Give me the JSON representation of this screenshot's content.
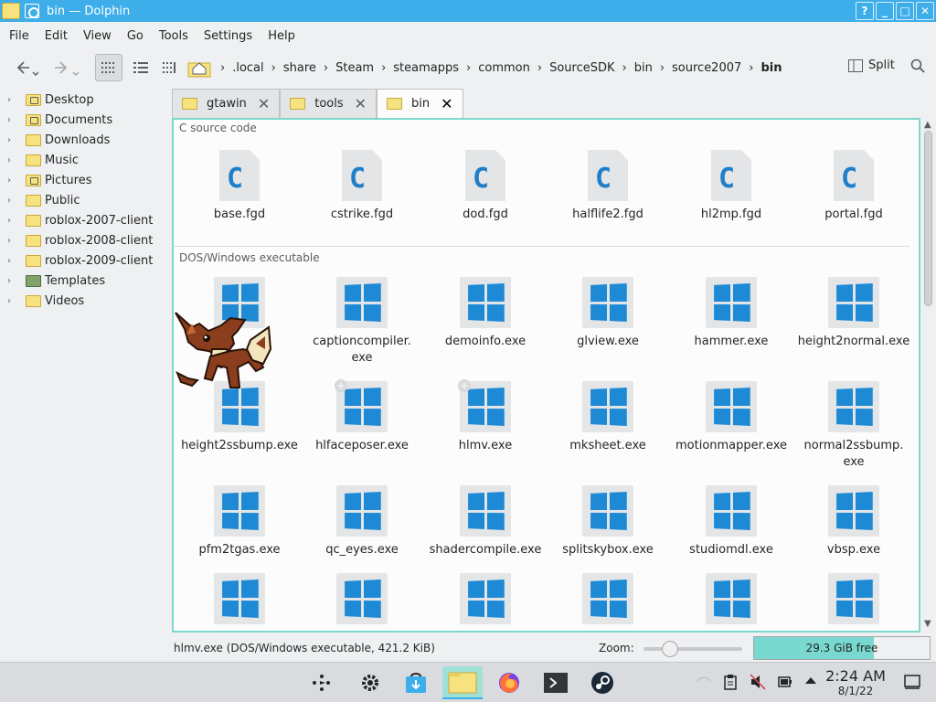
{
  "window": {
    "title": "bin — Dolphin",
    "buttons": [
      "?",
      "_",
      "□",
      "✕"
    ]
  },
  "menubar": [
    {
      "label": "File"
    },
    {
      "label": "Edit"
    },
    {
      "label": "View"
    },
    {
      "label": "Go"
    },
    {
      "label": "Tools"
    },
    {
      "label": "Settings"
    },
    {
      "label": "Help"
    }
  ],
  "toolbar": {
    "breadcrumbs": [
      ".local",
      "share",
      "Steam",
      "steamapps",
      "common",
      "SourceSDK",
      "bin",
      "source2007",
      "bin"
    ],
    "split_label": "Split"
  },
  "places": [
    {
      "label": "Desktop",
      "icon": "desktop-folder-icon"
    },
    {
      "label": "Documents",
      "icon": "documents-folder-icon"
    },
    {
      "label": "Downloads",
      "icon": "downloads-folder-icon"
    },
    {
      "label": "Music",
      "icon": "music-folder-icon"
    },
    {
      "label": "Pictures",
      "icon": "pictures-folder-icon"
    },
    {
      "label": "Public",
      "icon": "public-folder-icon"
    },
    {
      "label": "roblox-2007-client",
      "icon": "folder-icon"
    },
    {
      "label": "roblox-2008-client",
      "icon": "folder-icon"
    },
    {
      "label": "roblox-2009-client",
      "icon": "folder-icon"
    },
    {
      "label": "Templates",
      "icon": "templates-folder-icon"
    },
    {
      "label": "Videos",
      "icon": "videos-folder-icon"
    }
  ],
  "tabs": [
    {
      "label": "gtawin",
      "active": false
    },
    {
      "label": "tools",
      "active": false
    },
    {
      "label": "bin",
      "active": true
    }
  ],
  "groups": [
    {
      "label": "C source code",
      "files": [
        "base.fgd",
        "cstrike.fgd",
        "dod.fgd",
        "halflife2.fgd",
        "hl2mp.fgd",
        "portal.fgd"
      ]
    },
    {
      "label": "DOS/Windows executable",
      "files": [
        "",
        "captioncompiler.\nexe",
        "demoinfo.exe",
        "glview.exe",
        "hammer.exe",
        "height2normal.exe",
        "height2ssbump.exe",
        "hlfaceposer.exe",
        "hlmv.exe",
        "mksheet.exe",
        "motionmapper.exe",
        "normal2ssbump.\nexe",
        "pfm2tgas.exe",
        "qc_eyes.exe",
        "shadercompile.exe",
        "splitskybox.exe",
        "studiomdl.exe",
        "vbsp.exe",
        "",
        "",
        "",
        "",
        "",
        ""
      ]
    }
  ],
  "statusbar": {
    "info": "hlmv.exe (DOS/Windows executable, 421.2 KiB)",
    "zoom_label": "Zoom:",
    "free_space": "29.3 GiB free",
    "free_used_fraction": 0.68
  },
  "taskbar": {
    "apps": [
      "application-launcher-icon",
      "settings-icon",
      "discover-store-icon",
      "dolphin-file-manager-icon",
      "firefox-icon",
      "konsole-terminal-icon",
      "steam-icon"
    ],
    "time": "2:24 AM",
    "date": "8/1/22"
  },
  "colors": {
    "accent": "#3daee9",
    "selection_border": "#7ed9cd",
    "windows_blue": "#1e8ad6",
    "c_blue": "#1f7fc9"
  }
}
